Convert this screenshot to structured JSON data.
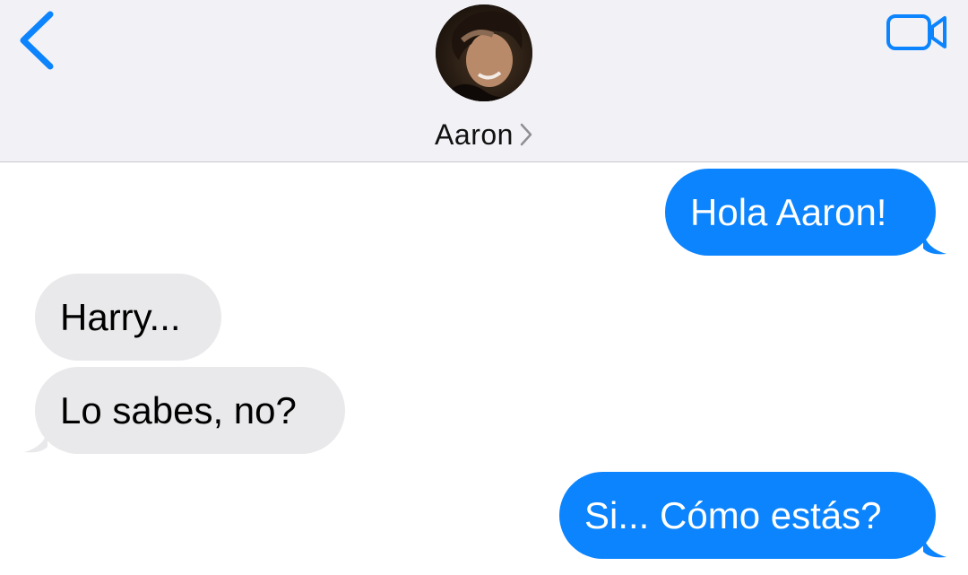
{
  "header": {
    "contact_name": "Aaron",
    "back_icon": "chevron-left-icon",
    "video_icon": "video-camera-icon",
    "accent_color": "#0b84fe",
    "background_color": "#f2f1f6"
  },
  "messages": [
    {
      "direction": "sent",
      "text": "Hola Aaron!"
    },
    {
      "direction": "received",
      "text": "Harry..."
    },
    {
      "direction": "received",
      "text": "Lo sabes, no?"
    },
    {
      "direction": "sent",
      "text": "Si... Cómo estás?"
    }
  ],
  "colors": {
    "sent_bubble": "#0b84fe",
    "received_bubble": "#e9e9eb"
  }
}
